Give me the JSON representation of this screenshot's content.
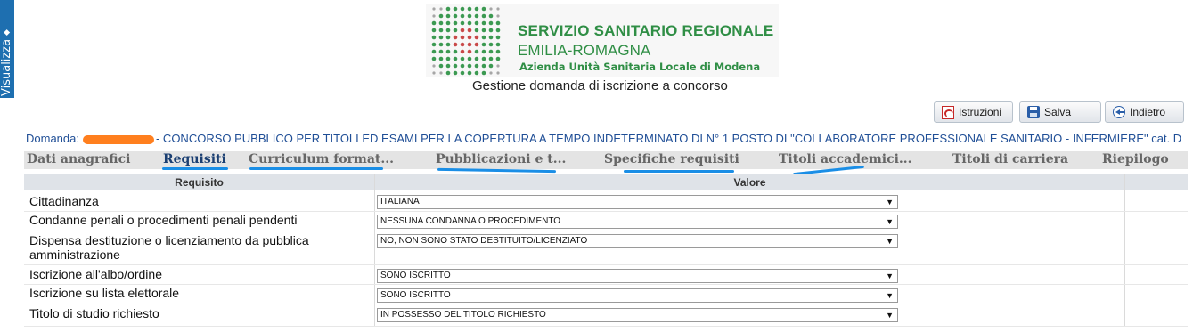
{
  "sidebar": {
    "label": "Visualizza",
    "arrow": "◆"
  },
  "header": {
    "logo_line1": "SERVIZIO SANITARIO REGIONALE",
    "logo_line2": "EMILIA-ROMAGNA",
    "logo_line3": "Azienda Unità Sanitaria Locale di Modena",
    "subtitle": "Gestione domanda di iscrizione a concorso",
    "logo_dot_colors": {
      "green": "#3c9a52",
      "red": "#c94949",
      "gray": "#a6a6a6"
    }
  },
  "toolbar": {
    "istruzioni_label": "Istruzioni",
    "salva_label": "Salva",
    "indietro_label": "Indietro"
  },
  "domanda": {
    "prefix": "Domanda:",
    "text": "- CONCORSO PUBBLICO PER TITOLI ED ESAMI PER LA COPERTURA A TEMPO INDETERMINATO DI N° 1 POSTO DI \"COLLABORATORE PROFESSIONALE SANITARIO - INFERMIERE\" cat. D"
  },
  "tabs": [
    {
      "label": "Dati anagrafici"
    },
    {
      "label": "Requisiti",
      "active": true
    },
    {
      "label": "Curriculum format..."
    },
    {
      "label": "Pubblicazioni e t..."
    },
    {
      "label": "Specifiche requisiti"
    },
    {
      "label": "Titoli accademici..."
    },
    {
      "label": "Titoli di carriera"
    },
    {
      "label": "Riepilogo"
    }
  ],
  "table": {
    "headers": {
      "requisito": "Requisito",
      "valore": "Valore"
    },
    "rows": [
      {
        "label": "Cittadinanza",
        "value": "ITALIANA"
      },
      {
        "label": "Condanne penali o procedimenti penali pendenti",
        "value": "NESSUNA CONDANNA O PROCEDIMENTO"
      },
      {
        "label": "Dispensa destituzione o licenziamento da pubblica amministrazione",
        "value": "NO, NON SONO STATO DESTITUITO/LICENZIATO"
      },
      {
        "label": "Iscrizione all'albo/ordine",
        "value": "SONO ISCRITTO"
      },
      {
        "label": "Iscrizione su lista elettorale",
        "value": "SONO ISCRITTO"
      },
      {
        "label": "Titolo di studio richiesto",
        "value": "IN POSSESSO DEL TITOLO RICHIESTO"
      }
    ]
  },
  "colors": {
    "accent_blue": "#1f4e96",
    "brand_green": "#2f8e45",
    "annotation_underline": "#1a8ee6",
    "redaction": "#ff7f1e"
  }
}
